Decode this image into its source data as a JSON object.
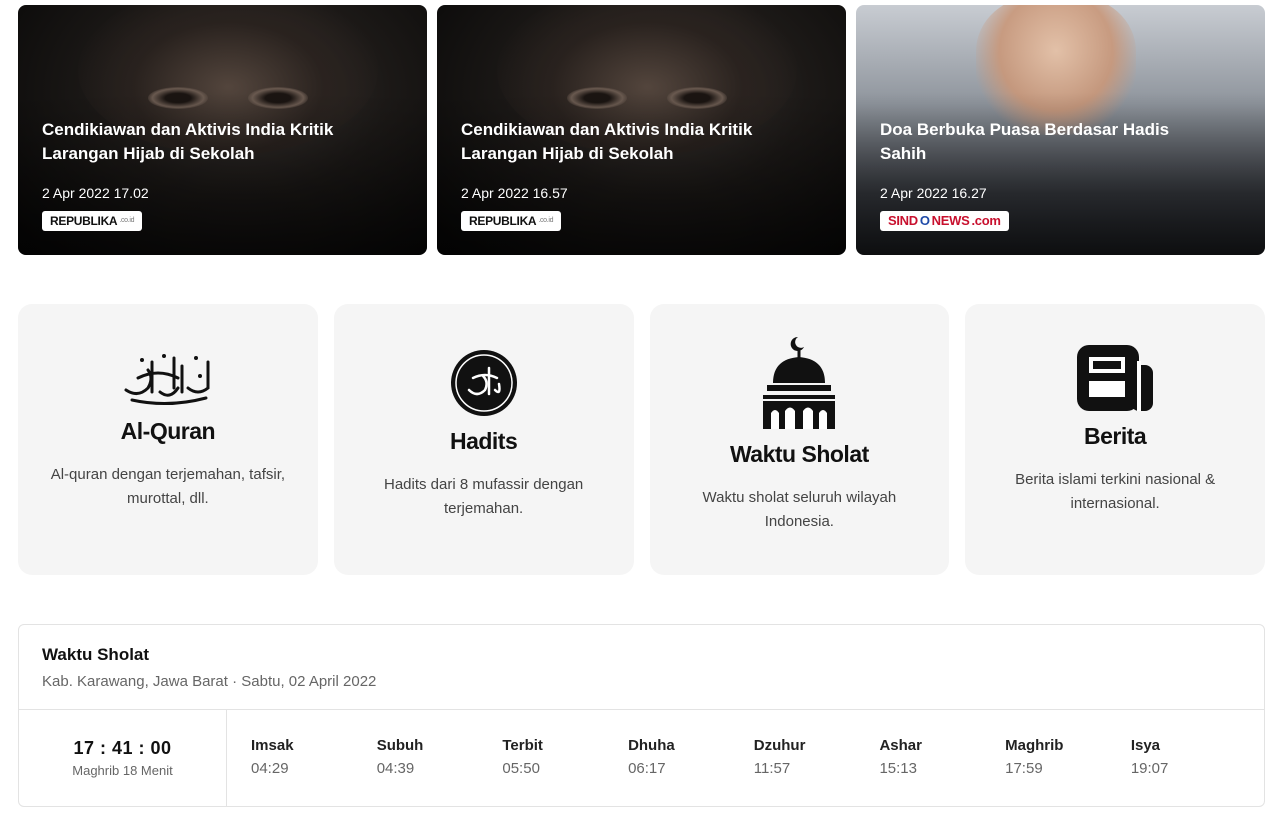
{
  "news": [
    {
      "title": "Cendikiawan dan Aktivis India Kritik Larangan Hijab di Sekolah",
      "date": "2 Apr 2022 17.02",
      "source": "REPUBLIKA",
      "source_suffix": ".co.id"
    },
    {
      "title": "Cendikiawan dan Aktivis India Kritik Larangan Hijab di Sekolah",
      "date": "2 Apr 2022 16.57",
      "source": "REPUBLIKA",
      "source_suffix": ".co.id"
    },
    {
      "title": "Doa Berbuka Puasa Berdasar Hadis Sahih",
      "date": "2 Apr 2022 16.27",
      "source_part1": "SIND",
      "source_part2": "O",
      "source_part3": "NEWS",
      "source_part4": ".com"
    }
  ],
  "features": [
    {
      "title": "Al-Quran",
      "desc": "Al-quran dengan terjemahan, tafsir, murottal, dll.",
      "icon": "quran-calligraphy-icon"
    },
    {
      "title": "Hadits",
      "desc": "Hadits dari 8 mufassir dengan terjemahan.",
      "icon": "hadits-seal-icon"
    },
    {
      "title": "Waktu Sholat",
      "desc": "Waktu sholat seluruh wilayah Indonesia.",
      "icon": "mosque-icon"
    },
    {
      "title": "Berita",
      "desc": "Berita islami terkini nasional & internasional.",
      "icon": "newspaper-icon"
    }
  ],
  "prayer": {
    "title": "Waktu Sholat",
    "location": "Kab. Karawang, Jawa Barat · Sabtu, 02 April 2022",
    "countdown": "17 : 41 : 00",
    "next": "Maghrib 18 Menit",
    "times": [
      {
        "name": "Imsak",
        "time": "04:29"
      },
      {
        "name": "Subuh",
        "time": "04:39"
      },
      {
        "name": "Terbit",
        "time": "05:50"
      },
      {
        "name": "Dhuha",
        "time": "06:17"
      },
      {
        "name": "Dzuhur",
        "time": "11:57"
      },
      {
        "name": "Ashar",
        "time": "15:13"
      },
      {
        "name": "Maghrib",
        "time": "17:59"
      },
      {
        "name": "Isya",
        "time": "19:07"
      }
    ]
  }
}
